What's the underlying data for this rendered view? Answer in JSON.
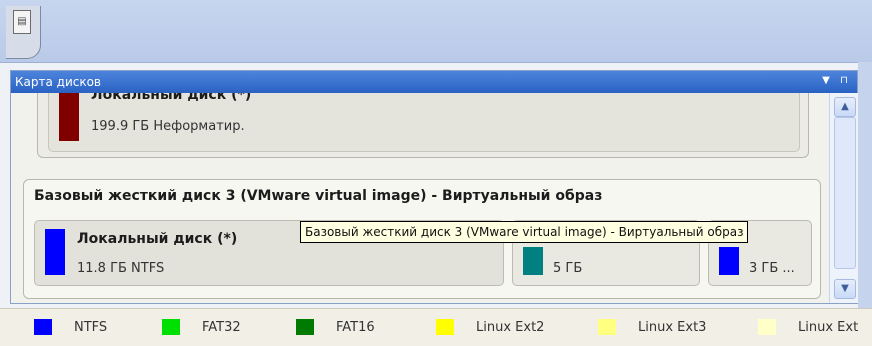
{
  "panel": {
    "title": "Карта дисков"
  },
  "disks": [
    {
      "title": "",
      "partitions": [
        {
          "name": "Локальный диск (*)",
          "info": "199.9 ГБ Неформатир.",
          "color": "#800000"
        }
      ]
    },
    {
      "title": "Базовый жесткий диск 3 (VMware virtual image) - Виртуальный образ",
      "partitions": [
        {
          "name": "Локальный диск (*)",
          "info": "11.8 ГБ NTFS",
          "color": "#0000ff"
        },
        {
          "name": "",
          "info": "5 ГБ",
          "color": "#008080"
        },
        {
          "name": "",
          "info": "3 ГБ ...",
          "color": "#0000ff"
        }
      ]
    }
  ],
  "tooltip": "Базовый жесткий диск 3 (VMware virtual image) - Виртуальный образ",
  "legend": [
    {
      "label": "NTFS",
      "color": "#0000ff"
    },
    {
      "label": "FAT32",
      "color": "#00e000"
    },
    {
      "label": "FAT16",
      "color": "#007a00"
    },
    {
      "label": "Linux Ext2",
      "color": "#ffff00"
    },
    {
      "label": "Linux Ext3",
      "color": "#ffff80"
    },
    {
      "label": "Linux Ext",
      "color": "#ffffc8"
    }
  ]
}
